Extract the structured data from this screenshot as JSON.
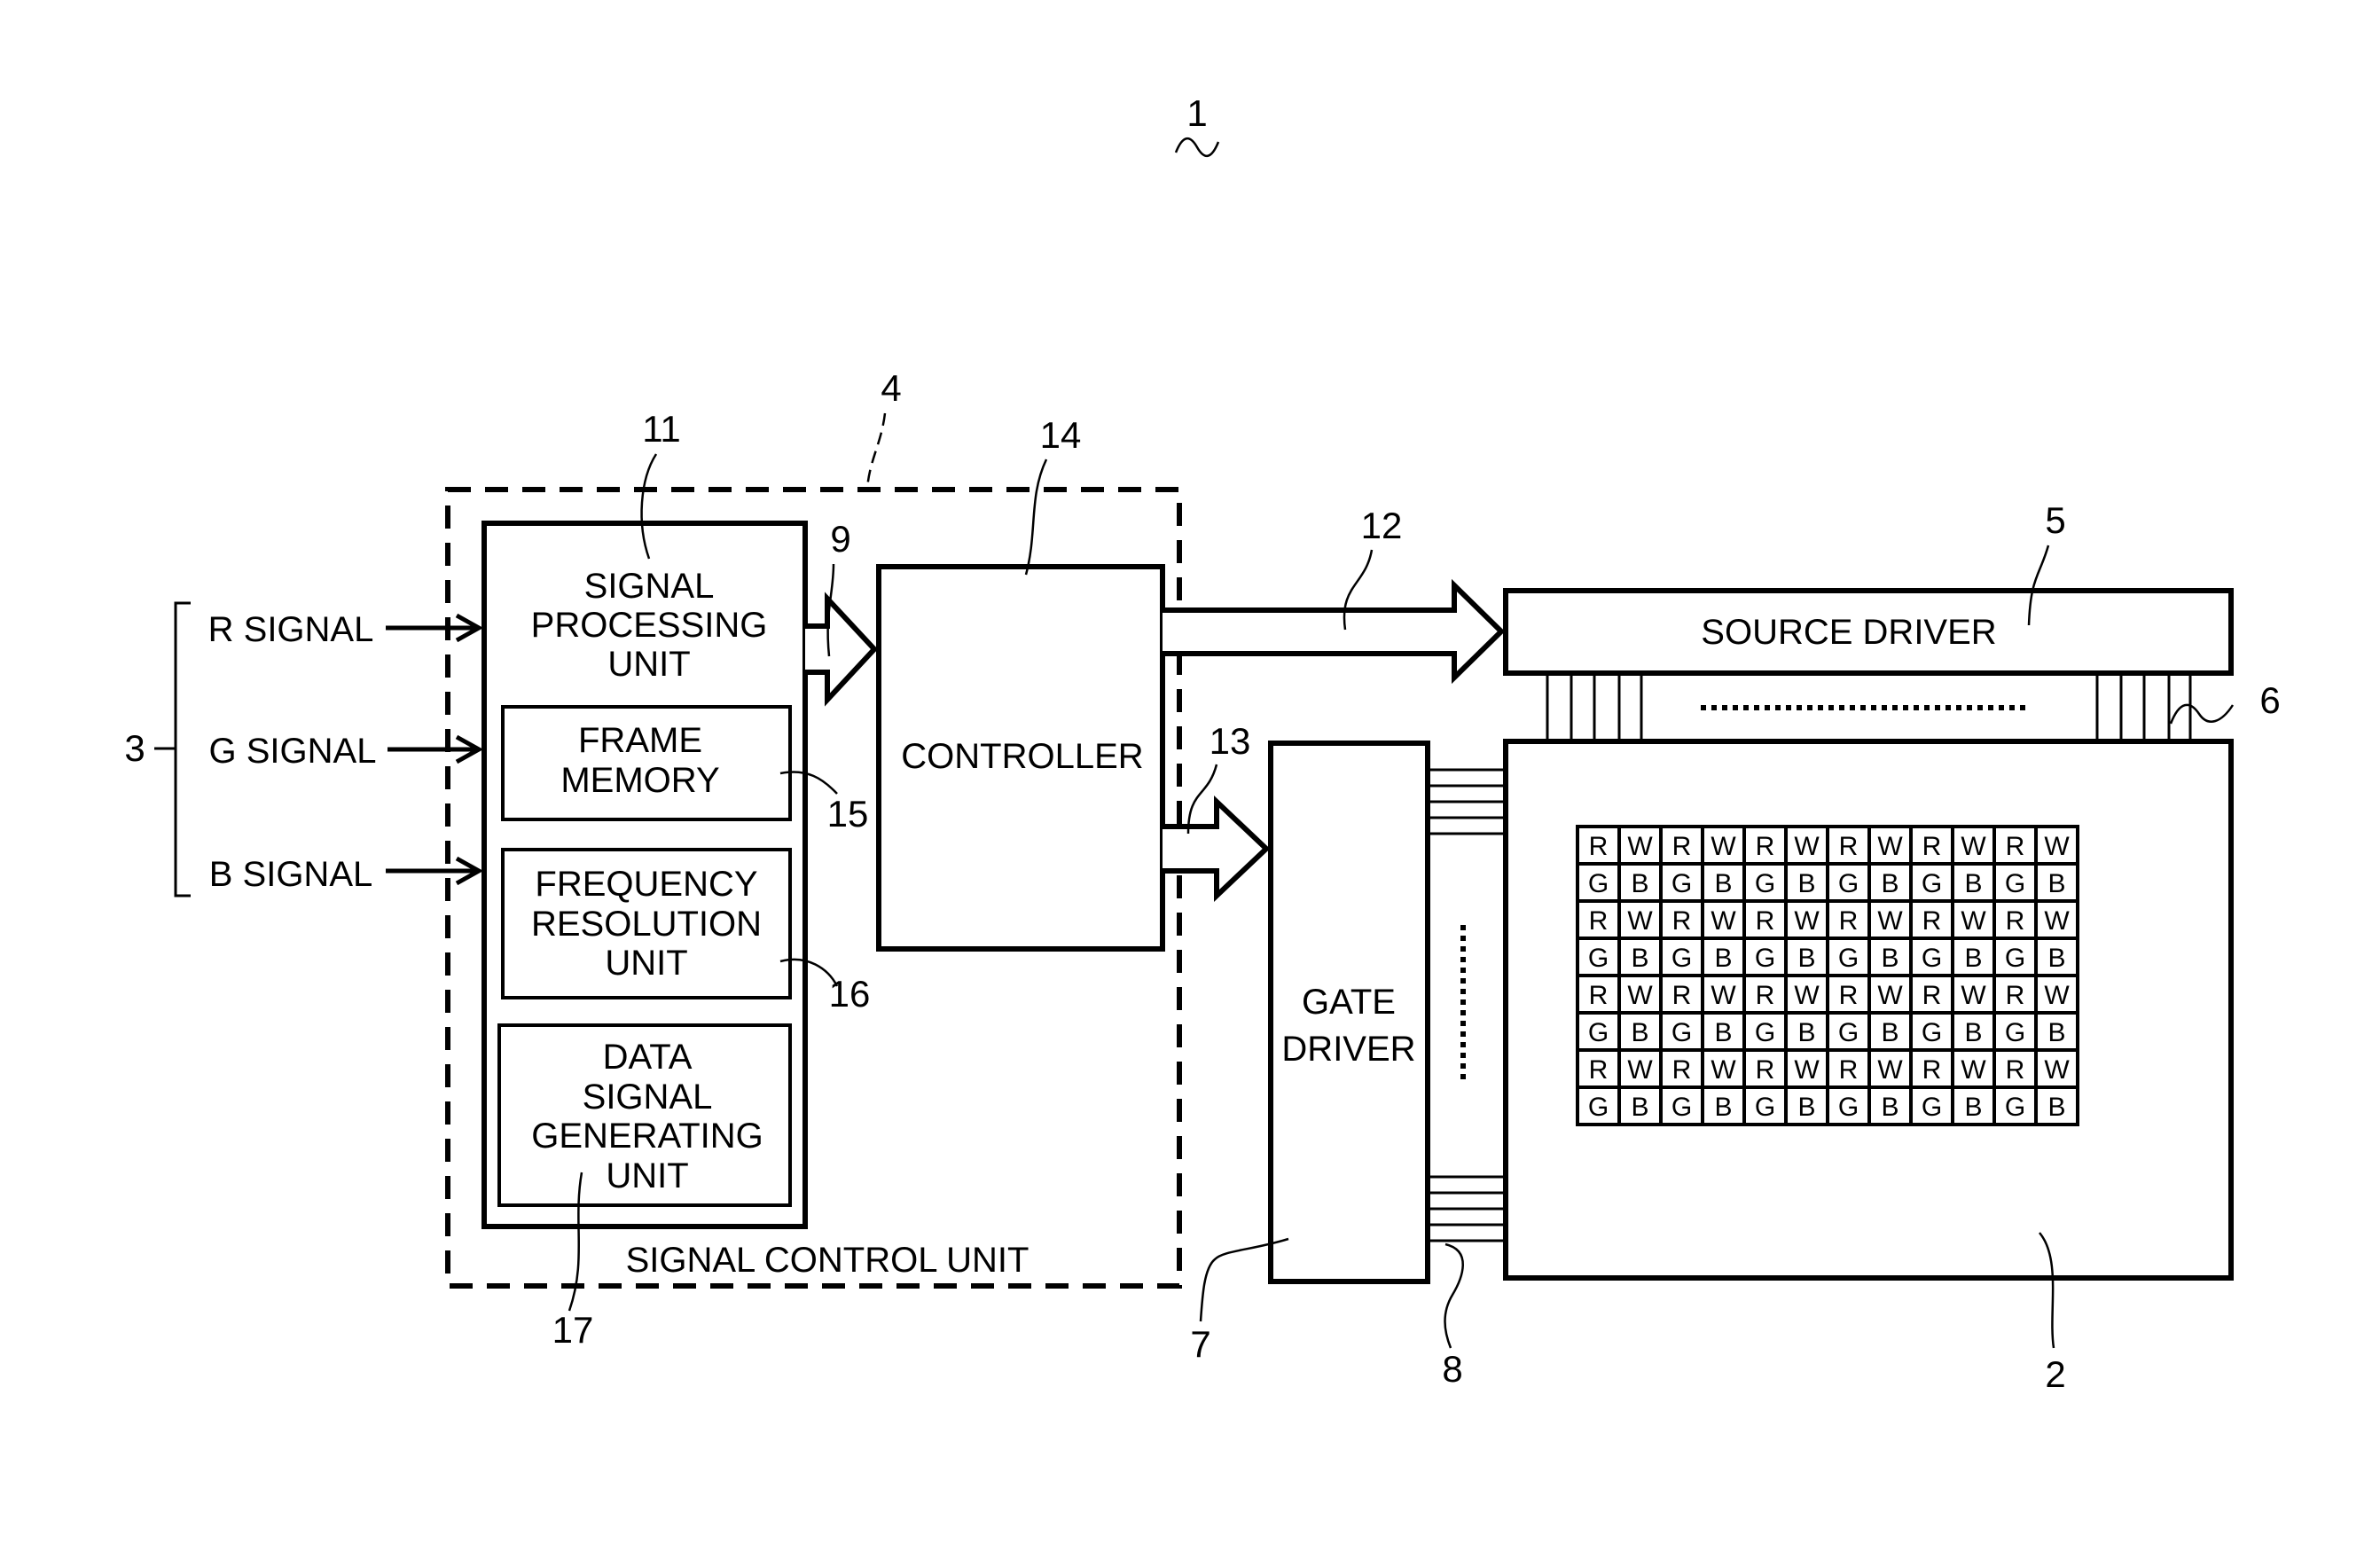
{
  "figure": {
    "ref_number": "1",
    "ref_tilde": "~"
  },
  "input_signals": {
    "group_ref": "3",
    "items": [
      {
        "label": "R SIGNAL"
      },
      {
        "label": "G SIGNAL"
      },
      {
        "label": "B SIGNAL"
      }
    ]
  },
  "signal_control_unit": {
    "ref": "4",
    "label": "SIGNAL CONTROL UNIT"
  },
  "signal_processing_unit": {
    "ref": "11",
    "lines": [
      "SIGNAL",
      "PROCESSING",
      "UNIT"
    ],
    "output_bus_ref": "9"
  },
  "frame_memory": {
    "ref": "15",
    "lines": [
      "FRAME",
      "MEMORY"
    ]
  },
  "frequency_resolution_unit": {
    "ref": "16",
    "lines": [
      "FREQUENCY",
      "RESOLUTION",
      "UNIT"
    ]
  },
  "data_signal_generating_unit": {
    "ref": "17",
    "lines": [
      "DATA",
      "SIGNAL",
      "GENERATING",
      "UNIT"
    ]
  },
  "controller": {
    "ref": "14",
    "label": "CONTROLLER",
    "source_bus_ref": "12",
    "gate_bus_ref": "13"
  },
  "source_driver": {
    "ref": "5",
    "label": "SOURCE DRIVER",
    "lines_ref": "6"
  },
  "gate_driver": {
    "ref": "7",
    "lines": [
      "GATE",
      "DRIVER"
    ],
    "lines_ref": "8"
  },
  "display_panel": {
    "ref": "2",
    "pixel_rows": [
      [
        "R",
        "W",
        "R",
        "W",
        "R",
        "W",
        "R",
        "W",
        "R",
        "W",
        "R",
        "W"
      ],
      [
        "G",
        "B",
        "G",
        "B",
        "G",
        "B",
        "G",
        "B",
        "G",
        "B",
        "G",
        "B"
      ],
      [
        "R",
        "W",
        "R",
        "W",
        "R",
        "W",
        "R",
        "W",
        "R",
        "W",
        "R",
        "W"
      ],
      [
        "G",
        "B",
        "G",
        "B",
        "G",
        "B",
        "G",
        "B",
        "G",
        "B",
        "G",
        "B"
      ],
      [
        "R",
        "W",
        "R",
        "W",
        "R",
        "W",
        "R",
        "W",
        "R",
        "W",
        "R",
        "W"
      ],
      [
        "G",
        "B",
        "G",
        "B",
        "G",
        "B",
        "G",
        "B",
        "G",
        "B",
        "G",
        "B"
      ],
      [
        "R",
        "W",
        "R",
        "W",
        "R",
        "W",
        "R",
        "W",
        "R",
        "W",
        "R",
        "W"
      ],
      [
        "G",
        "B",
        "G",
        "B",
        "G",
        "B",
        "G",
        "B",
        "G",
        "B",
        "G",
        "B"
      ]
    ]
  }
}
